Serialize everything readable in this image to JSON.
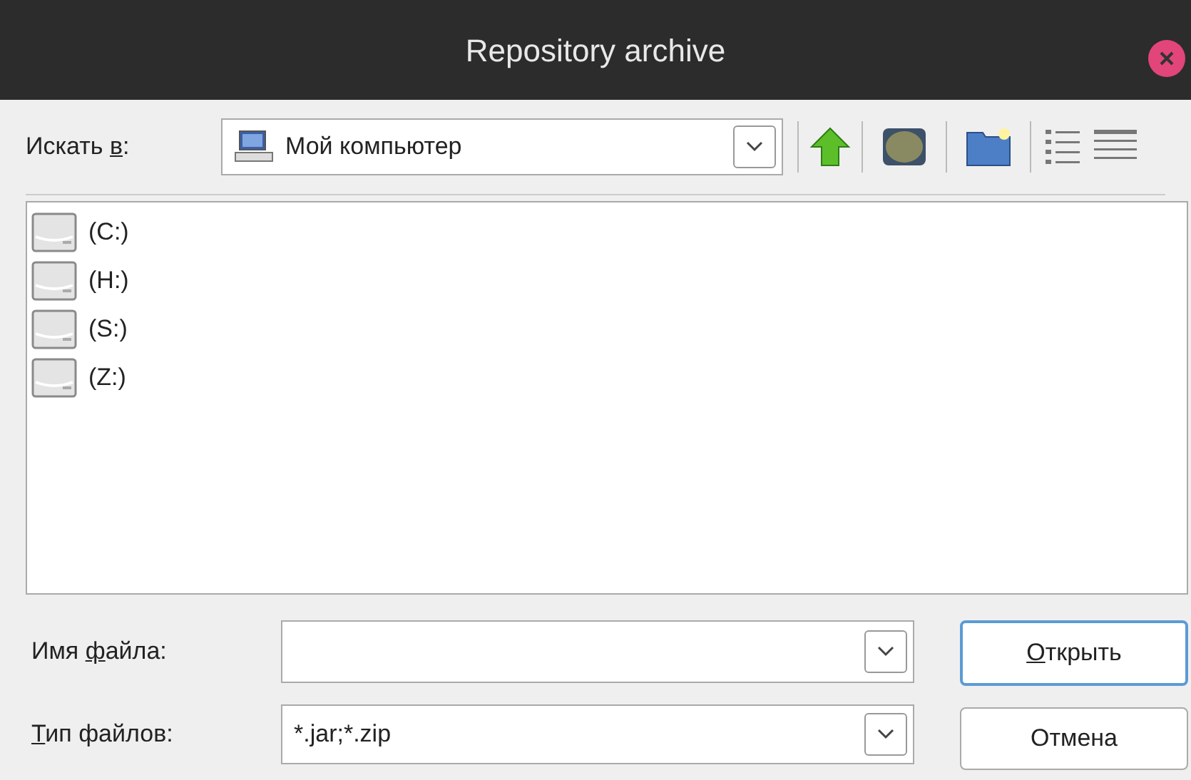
{
  "window": {
    "title": "Repository archive"
  },
  "look_in": {
    "label": {
      "before": "Искать ",
      "mnemonic": "в",
      "after": ":"
    },
    "value": "Мой компьютер"
  },
  "files": [
    {
      "name": "(C:)"
    },
    {
      "name": "(H:)"
    },
    {
      "name": "(S:)"
    },
    {
      "name": "(Z:)"
    }
  ],
  "file_name": {
    "label": {
      "before": "Имя ",
      "mnemonic": "ф",
      "after": "айла:"
    }
  },
  "file_type": {
    "label": {
      "mnemonic": "Т",
      "after": "ип файлов:"
    },
    "value": "*.jar;*.zip"
  },
  "buttons": [
    {
      "label": {
        "mnemonic": "О",
        "after": "ткрыть"
      },
      "default": true
    },
    {
      "label": {
        "after": "Отмена"
      },
      "default": false
    }
  ]
}
